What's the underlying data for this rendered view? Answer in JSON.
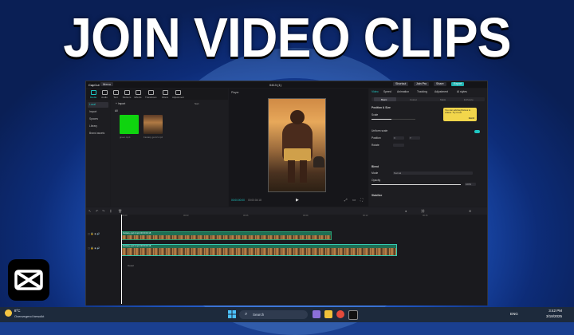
{
  "headline": "JOIN VIDEO CLIPS",
  "app": {
    "logo": "CapCut",
    "menu_label": "Menu",
    "window_title": "0413 (1)",
    "shortcut_label": "Shortcut",
    "joinpro_label": "Join Pro",
    "share_label": "Share",
    "export_label": "Export"
  },
  "media_tabs": [
    "Media",
    "Audio",
    "Text",
    "Stickers",
    "Effects",
    "Transitions",
    "Filters",
    "Adjustment"
  ],
  "left_nav": [
    "Local",
    "Import",
    "Spaces",
    "Library",
    "Brand assets"
  ],
  "media_panel": {
    "import_label": "Import",
    "all_label": "All",
    "sort_label": "Sort",
    "thumb1_label": "green.mp4",
    "thumb2_label": "Fantasy god 2.mp4"
  },
  "player": {
    "label": "Player",
    "timecode": "00:00:00:00",
    "duration": "00:00:04:18"
  },
  "props": {
    "tabs": [
      "Video",
      "Speed",
      "Animation",
      "Tracking",
      "Adjustment",
      "AI styles"
    ],
    "subtabs": [
      "Basic",
      "Cutout",
      "Mask",
      "Enhance"
    ],
    "position_size": "Position & Size",
    "scale": "Scale",
    "uniform_scale": "Uniform scale",
    "position": "Position",
    "rotate": "Rotate",
    "blend": "Blend",
    "mode": "Mode",
    "mode_value": "Normal",
    "opacity": "Opacity",
    "opacity_value": "100%",
    "stabilize": "Stabilize",
    "tooltip_text": "You can add keyframes to videos. Try it out!",
    "tooltip_ok": "Got it"
  },
  "timeline": {
    "clip1_label": "Fantasy god 2.mp4  00:00:04:18",
    "clip2_label": "Fantasy god 2.mp4  00:00:04:18",
    "cover_label": "Cover",
    "ticks": [
      "00:00",
      "00:03",
      "00:06",
      "00:09",
      "00:12",
      "00:15"
    ]
  },
  "taskbar": {
    "temp": "8°C",
    "weather": "Overwegend bewolkt",
    "search_placeholder": "Search",
    "lang": "ENG",
    "time": "3:42 PM",
    "date": "3/18/2025"
  }
}
